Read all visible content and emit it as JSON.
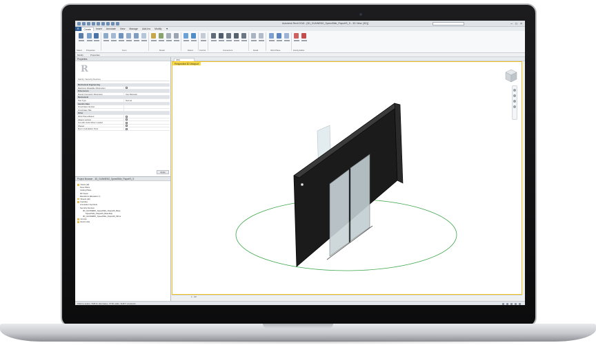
{
  "window": {
    "title": "Autodesk Revit 2018 - [3D_GUNNEBO_SpeedStile_FlapsHS_S - 3D View: {3D}]",
    "controls": [
      "–",
      "□",
      "×"
    ]
  },
  "ribbon": {
    "tabs": [
      "R",
      "Create",
      "Insert",
      "Annotate",
      "View",
      "Manage",
      "Add-Ins",
      "Modify",
      "▼"
    ],
    "active_tab_index": 1,
    "groups": [
      "Select",
      "Properties",
      "Form",
      "Datum",
      "Model",
      "Control",
      "Connectors",
      "Detail",
      "Work Plane",
      "Family Editor"
    ]
  },
  "options_bar": {
    "modify_label": "Modify",
    "properties_label": "Properties"
  },
  "properties": {
    "panel_title": "Properties",
    "family_type": "Family: Security Devices",
    "section_label": "Constraints",
    "search_placeholder": "Filter",
    "rows": [
      {
        "group": true,
        "key": "Mechanical Engineering"
      },
      {
        "key": "Maximum Allowable Obstruction",
        "check": true
      },
      {
        "group": true,
        "key": "Dimensions"
      },
      {
        "key": "Round Connector Dimension",
        "value": "Use Diameter"
      },
      {
        "group": true,
        "key": "Mechanical"
      },
      {
        "key": "Part Type",
        "value": "Normal"
      },
      {
        "group": true,
        "key": "Identity Data"
      },
      {
        "key": "OmniClass Number",
        "value": ""
      },
      {
        "key": "OmniClass Title",
        "value": ""
      },
      {
        "group": true,
        "key": "Other"
      },
      {
        "key": "Work Plane-Based",
        "check": true
      },
      {
        "key": "Always vertical",
        "check": true
      },
      {
        "key": "Cut with Voids When Loaded",
        "check": true
      },
      {
        "key": "Shared",
        "check": true
      },
      {
        "key": "Room Calculation Point",
        "check": true
      }
    ],
    "apply_label": "Apply"
  },
  "project_browser": {
    "title": "Project Browser - 3D_GUNNEBO_SpeedStile_FlapsHS_S",
    "nodes": [
      {
        "label": "Views (all)",
        "level": 0,
        "folder": true
      },
      {
        "label": "Floor Plans",
        "level": 1,
        "folder": false
      },
      {
        "label": "Ceiling Plans",
        "level": 1,
        "folder": false
      },
      {
        "label": "3D Views",
        "level": 1,
        "folder": false
      },
      {
        "label": "Elevations (Elevation 1)",
        "level": 1,
        "folder": false
      },
      {
        "label": "Sheets (all)",
        "level": 0,
        "folder": true
      },
      {
        "label": "Families",
        "level": 0,
        "folder": true
      },
      {
        "label": "Annotation Symbols",
        "level": 1,
        "folder": false
      },
      {
        "label": "Security Devices",
        "level": 1,
        "folder": false
      },
      {
        "label": "3D_GUNNEBO_SpeedStile_FlapsHS_Base",
        "level": 2,
        "folder": false
      },
      {
        "label": "SpeedStile_FlapsHS_BaseFlap",
        "level": 3,
        "folder": false
      },
      {
        "label": "3D_GUNNEBO_SpeedStile_FlapsHS_Mirror",
        "level": 2,
        "folder": false
      },
      {
        "label": "Groups",
        "level": 0,
        "folder": true
      },
      {
        "label": "Revit Links",
        "level": 0,
        "folder": true
      }
    ]
  },
  "view": {
    "tab_label": "{3D}",
    "label": "Perspective 3D Viewport",
    "control_bar": "1 : 20"
  },
  "statusbar": {
    "text": "Click to select, TAB for alternates, CTRL adds, SHIFT unselects."
  },
  "colors": {
    "active_view_border": "#f2c31b",
    "file_tab": "#2f5f9a",
    "model_dark": "#1b1b1b",
    "ground_circle": "#3aa547"
  }
}
